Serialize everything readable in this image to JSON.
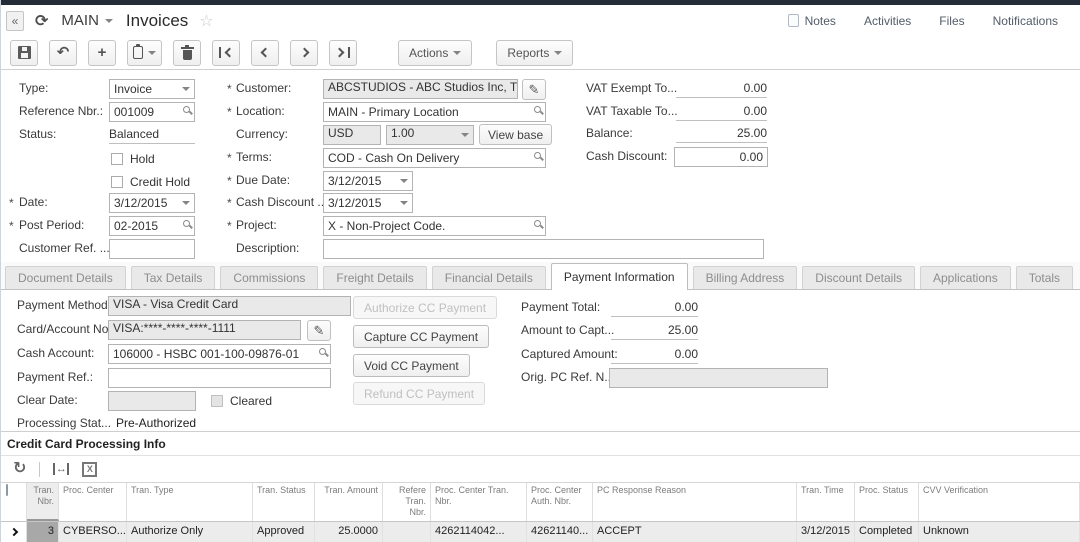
{
  "titlebar": {
    "branch": "MAIN",
    "title": "Invoices",
    "links": {
      "notes": "Notes",
      "activities": "Activities",
      "files": "Files",
      "notifications": "Notifications"
    }
  },
  "toolbar": {
    "actions": "Actions",
    "reports": "Reports"
  },
  "icons": {
    "collapse": "«",
    "refresh": "⟳",
    "star": "☆",
    "plus": "+",
    "undo": "↶",
    "grid_refresh": "↻",
    "fit_arrow": "↔",
    "excel_x": "X",
    "pencil": "✎",
    "search-icon": "css-lens",
    "caret-down-icon": "css-triangle"
  },
  "marks": {
    "required": "*"
  },
  "summary": {
    "type": {
      "label": "Type:",
      "value": "Invoice"
    },
    "reference": {
      "label": "Reference Nbr.:",
      "value": "001009"
    },
    "status": {
      "label": "Status:",
      "value": "Balanced"
    },
    "hold": "Hold",
    "credit_hold": "Credit Hold",
    "date": {
      "label": "Date:",
      "value": "3/12/2015"
    },
    "post_period": {
      "label": "Post Period:",
      "value": "02-2015"
    },
    "customer_ref": {
      "label": "Customer Ref. ...",
      "value": ""
    },
    "customer": {
      "label": "Customer:",
      "value": "ABCSTUDIOS - ABC Studios Inc, Th"
    },
    "location": {
      "label": "Location:",
      "value": "MAIN - Primary Location"
    },
    "currency": {
      "label": "Currency:",
      "code": "USD",
      "rate": "1.00",
      "view_base": "View base"
    },
    "terms": {
      "label": "Terms:",
      "value": "COD - Cash On Delivery"
    },
    "due_date": {
      "label": "Due Date:",
      "value": "3/12/2015"
    },
    "cash_discount_date": {
      "label": "Cash Discount ...",
      "value": "3/12/2015"
    },
    "project": {
      "label": "Project:",
      "value": "X - Non-Project Code."
    },
    "description": {
      "label": "Description:",
      "value": ""
    },
    "vat_exempt": {
      "label": "VAT Exempt To...",
      "value": "0.00"
    },
    "vat_taxable": {
      "label": "VAT Taxable To...",
      "value": "0.00"
    },
    "balance": {
      "label": "Balance:",
      "value": "25.00"
    },
    "cash_discount": {
      "label": "Cash Discount:",
      "value": "0.00"
    }
  },
  "tabs": [
    "Document Details",
    "Tax Details",
    "Commissions",
    "Freight Details",
    "Financial Details",
    "Payment Information",
    "Billing Address",
    "Discount Details",
    "Applications",
    "Totals"
  ],
  "payment": {
    "method": {
      "label": "Payment Method:",
      "value": "VISA - Visa Credit Card"
    },
    "card": {
      "label": "Card/Account No:",
      "value": "VISA:****-****-****-1111"
    },
    "cash_account": {
      "label": "Cash Account:",
      "value": "106000 - HSBC 001-100-09876-01"
    },
    "payment_ref": {
      "label": "Payment Ref.:",
      "value": ""
    },
    "clear_date": {
      "label": "Clear Date:",
      "value": "",
      "cleared": "Cleared"
    },
    "processing_status": {
      "label": "Processing Stat...",
      "value": "Pre-Authorized"
    },
    "buttons": {
      "authorize": "Authorize CC Payment",
      "capture": "Capture CC Payment",
      "void": "Void CC Payment",
      "refund": "Refund CC Payment"
    },
    "payment_total": {
      "label": "Payment Total:",
      "value": "0.00"
    },
    "amount_to_capture": {
      "label": "Amount to Capt...",
      "value": "25.00"
    },
    "captured_amount": {
      "label": "Captured Amount:",
      "value": "0.00"
    },
    "orig_pc_ref": {
      "label": "Orig. PC Ref. N...",
      "value": ""
    }
  },
  "cc_grid": {
    "title": "Credit Card Processing Info",
    "headers": [
      "Tran. Nbr.",
      "Proc. Center",
      "Tran. Type",
      "Tran. Status",
      "Tran. Amount",
      "Refere Tran. Nbr.",
      "Proc. Center Tran. Nbr.",
      "Proc. Center Auth. Nbr.",
      "PC Response Reason",
      "Tran. Time",
      "Proc. Status",
      "CVV Verification"
    ],
    "rows": [
      [
        "3",
        "CYBERSO...",
        "Authorize Only",
        "Approved",
        "25.0000",
        "",
        "4262114042...",
        "42621140...",
        "ACCEPT",
        "3/12/2015",
        "Completed",
        "Unknown"
      ]
    ]
  }
}
